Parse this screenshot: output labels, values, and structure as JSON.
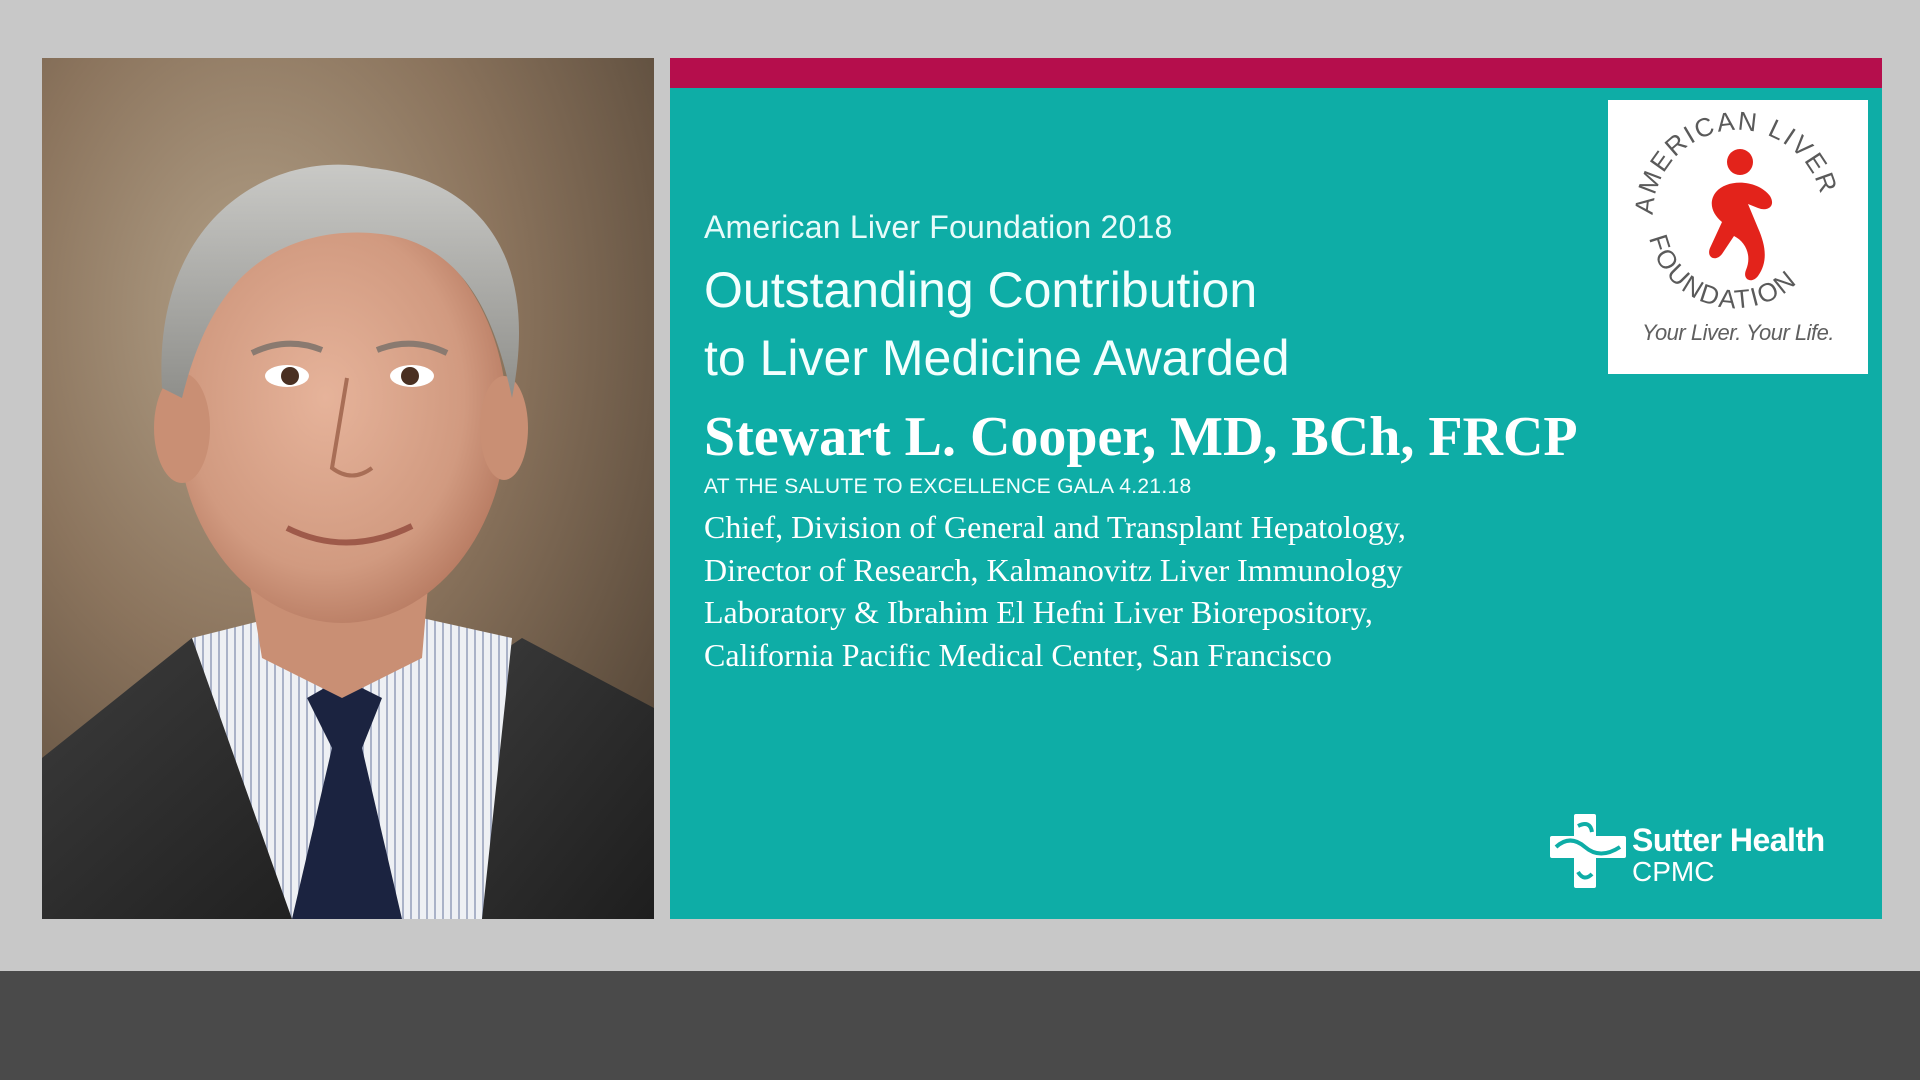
{
  "header": {
    "org_year": "American Liver Foundation 2018",
    "award_line_1": "Outstanding Contribution",
    "award_line_2": "to Liver Medicine Awarded"
  },
  "honoree": {
    "name": "Stewart L. Cooper, MD, BCh, FRCP",
    "event": "AT THE SALUTE TO EXCELLENCE GALA 4.21.18",
    "credentials": [
      "Chief, Division of General and Transplant Hepatology,",
      "Director of Research, Kalmanovitz Liver Immunology",
      "Laboratory & Ibrahim El Hefni Liver Biorepository,",
      "California Pacific Medical Center, San Francisco"
    ]
  },
  "alf_logo": {
    "ring_text_top": "AMERICAN LIVER",
    "ring_text_bottom": "FOUNDATION",
    "tagline": "Your Liver. Your Life."
  },
  "sutter_logo": {
    "name": "Sutter Health",
    "sub": "CPMC"
  },
  "colors": {
    "card_teal": "#0eada6",
    "stripe_magenta": "#b50e4c",
    "alf_red": "#e3231b",
    "background_gray": "#c8c8c8",
    "bottom_bar": "#4a4a4a"
  }
}
